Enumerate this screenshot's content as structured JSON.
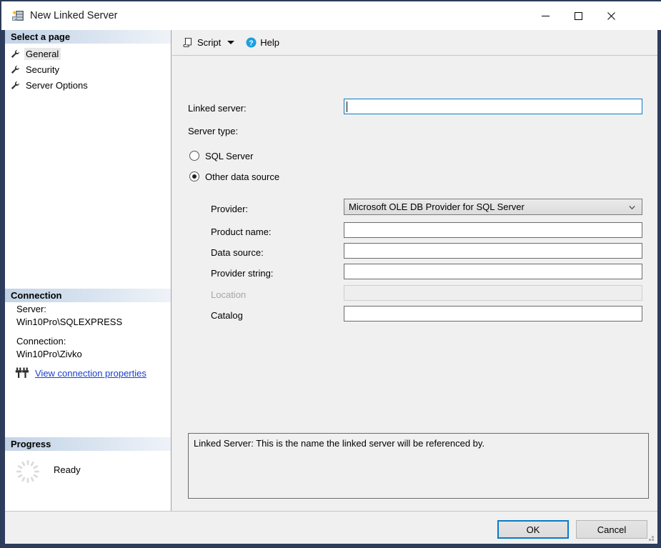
{
  "window": {
    "title": "New Linked Server",
    "icon": "new-linked-server-icon",
    "minimize_label": "—",
    "maximize_label": "□",
    "close_label": "✕"
  },
  "sidebar": {
    "select_page_header": "Select a page",
    "items": [
      {
        "label": "General",
        "selected": true
      },
      {
        "label": "Security",
        "selected": false
      },
      {
        "label": "Server Options",
        "selected": false
      }
    ],
    "connection": {
      "header": "Connection",
      "server_label": "Server:",
      "server_value": "Win10Pro\\SQLEXPRESS",
      "connection_label": "Connection:",
      "connection_value": "Win10Pro\\Zivko",
      "properties_link": "View connection properties"
    },
    "progress": {
      "header": "Progress",
      "status": "Ready"
    }
  },
  "toolbar": {
    "script_label": "Script",
    "help_label": "Help"
  },
  "form": {
    "linked_server_label": "Linked server:",
    "linked_server_value": "",
    "server_type_label": "Server type:",
    "radios": [
      {
        "label": "SQL Server",
        "checked": false
      },
      {
        "label": "Other data source",
        "checked": true
      }
    ],
    "provider_label": "Provider:",
    "provider_value": "Microsoft OLE DB Provider for SQL Server",
    "product_name_label": "Product name:",
    "product_name_value": "",
    "data_source_label": "Data source:",
    "data_source_value": "",
    "provider_string_label": "Provider string:",
    "provider_string_value": "",
    "location_label": "Location",
    "location_value": "",
    "catalog_label": "Catalog",
    "catalog_value": ""
  },
  "description": {
    "text": "Linked Server: This is the name the linked server will be referenced by."
  },
  "footer": {
    "ok_label": "OK",
    "cancel_label": "Cancel"
  },
  "colors": {
    "frame": "#2e3d5c",
    "pane_background": "#f0f0f0",
    "section_header_start": "#c3d3e6",
    "focus_blue": "#0a7ac7",
    "link_blue": "#1a3fd0",
    "help_icon_blue": "#1c9fe0"
  }
}
